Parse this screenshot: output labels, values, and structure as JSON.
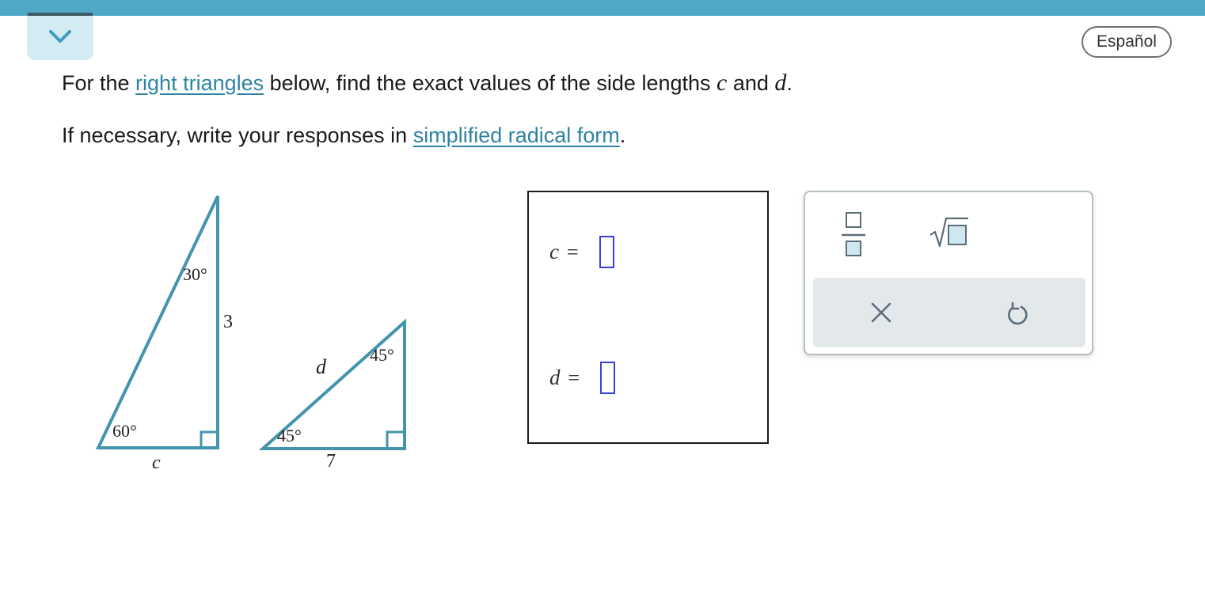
{
  "header": {
    "collapse_icon": "chevron-down-icon",
    "language_label": "Español"
  },
  "question": {
    "line1_pre": "For the ",
    "line1_link": "right triangles",
    "line1_mid": " below, find the exact values of the side lengths ",
    "var_c": "c",
    "line1_and": " and ",
    "var_d": "d",
    "line1_end": ".",
    "line2_pre": "If necessary, write your responses in ",
    "line2_link": "simplified radical form",
    "line2_end": "."
  },
  "figure": {
    "triangle1": {
      "top_angle": "30°",
      "bottom_angle": "60°",
      "vertical_side": "3",
      "base_label": "c"
    },
    "triangle2": {
      "top_angle": "45°",
      "bottom_angle": "45°",
      "hyp_label": "d",
      "base_label": "7"
    },
    "stroke_color": "#4394ad"
  },
  "answers": {
    "c_label": "c",
    "d_label": "d",
    "equals": "=",
    "c_value": "",
    "d_value": ""
  },
  "toolbox": {
    "fraction_icon": "fraction-icon",
    "sqrt_icon": "square-root-icon",
    "clear_icon": "close-icon",
    "undo_icon": "undo-icon"
  },
  "colors": {
    "topbar": "#4fa9c6",
    "link": "#2e84a3",
    "input_border": "#3b3fe0",
    "tray": "#e3e8eb"
  }
}
